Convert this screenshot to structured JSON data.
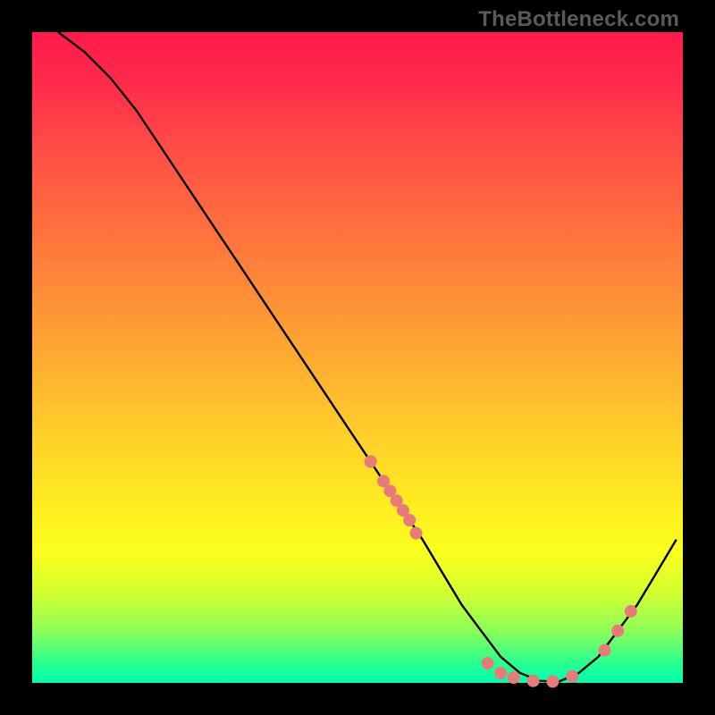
{
  "watermark": "TheBottleneck.com",
  "colors": {
    "dot": "#e97a7a",
    "curve": "#000000",
    "bg_top": "#ff1a4d",
    "bg_bottom": "#00ffb0"
  },
  "chart_data": {
    "type": "line",
    "title": "",
    "xlabel": "",
    "ylabel": "",
    "xlim": [
      0,
      100
    ],
    "ylim": [
      0,
      100
    ],
    "series": [
      {
        "name": "curve",
        "x": [
          4,
          8,
          12,
          16,
          20,
          24,
          28,
          32,
          36,
          40,
          44,
          48,
          52,
          56,
          60,
          63,
          66,
          69,
          72,
          75,
          78,
          81,
          84,
          87,
          90,
          93,
          96,
          99
        ],
        "y": [
          100,
          97,
          93,
          88,
          82,
          76,
          70,
          64,
          58,
          52,
          46,
          40,
          34,
          28,
          22,
          17,
          12,
          8,
          4,
          1.5,
          0.3,
          0.2,
          1.5,
          4,
          8,
          12,
          17,
          22
        ]
      }
    ],
    "points": [
      {
        "x": 52,
        "y": 34
      },
      {
        "x": 54,
        "y": 31
      },
      {
        "x": 55,
        "y": 29.5
      },
      {
        "x": 56,
        "y": 28
      },
      {
        "x": 57,
        "y": 26.5
      },
      {
        "x": 58,
        "y": 25
      },
      {
        "x": 59,
        "y": 23
      },
      {
        "x": 70,
        "y": 3
      },
      {
        "x": 72,
        "y": 1.5
      },
      {
        "x": 74,
        "y": 0.8
      },
      {
        "x": 77,
        "y": 0.3
      },
      {
        "x": 80,
        "y": 0.2
      },
      {
        "x": 83,
        "y": 1
      },
      {
        "x": 88,
        "y": 5
      },
      {
        "x": 90,
        "y": 8
      },
      {
        "x": 92,
        "y": 11
      }
    ],
    "annotations": []
  }
}
